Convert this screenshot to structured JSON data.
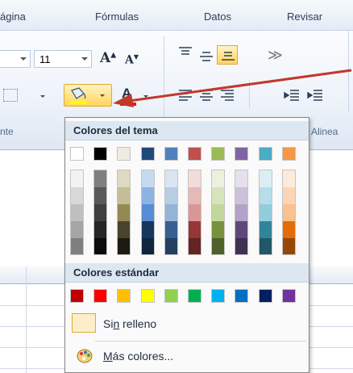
{
  "tabs": [
    "ágina",
    "Fórmulas",
    "Datos",
    "Revisar"
  ],
  "ribbon": {
    "font_size": "11",
    "group_label_font": "nte",
    "group_label_align": "Alinea"
  },
  "dropdown": {
    "theme_header": "Colores del tema",
    "standard_header": "Colores estándar",
    "no_fill_label_a": "Si",
    "no_fill_label_u": "n",
    "no_fill_label_b": " relleno",
    "more_colors_u": "M",
    "more_colors_rest": "ás colores...",
    "theme_top": [
      "#ffffff",
      "#000000",
      "#eeece1",
      "#1f497d",
      "#4f81bd",
      "#c0504d",
      "#9bbb59",
      "#8064a2",
      "#4bacc6",
      "#f79646"
    ],
    "theme_tints": [
      [
        "#f2f2f2",
        "#d8d8d8",
        "#bfbfbf",
        "#a5a5a5",
        "#7f7f7f"
      ],
      [
        "#7f7f7f",
        "#595959",
        "#3f3f3f",
        "#262626",
        "#0c0c0c"
      ],
      [
        "#ddd9c3",
        "#c4bd97",
        "#938953",
        "#494429",
        "#1d1b10"
      ],
      [
        "#c6d9f0",
        "#8db3e2",
        "#548dd4",
        "#17365d",
        "#0f243e"
      ],
      [
        "#dbe5f1",
        "#b8cce4",
        "#95b3d7",
        "#366092",
        "#244061"
      ],
      [
        "#f2dcdb",
        "#e5b9b7",
        "#d99694",
        "#953734",
        "#632423"
      ],
      [
        "#ebf1dd",
        "#d7e3bc",
        "#c3d69b",
        "#76923c",
        "#4f6128"
      ],
      [
        "#e5e0ec",
        "#ccc1d9",
        "#b2a2c7",
        "#5f497a",
        "#3f3151"
      ],
      [
        "#dbeef3",
        "#b7dde8",
        "#92cddc",
        "#31859b",
        "#205867"
      ],
      [
        "#fdeada",
        "#fbd5b5",
        "#fac08f",
        "#e36c09",
        "#974806"
      ]
    ],
    "standard": [
      "#c00000",
      "#ff0000",
      "#ffc000",
      "#ffff00",
      "#92d050",
      "#00b050",
      "#00b0f0",
      "#0070c0",
      "#002060",
      "#7030a0"
    ]
  },
  "icons": {
    "fill_bucket": "paint-bucket-icon",
    "font_color": "font-color-icon",
    "palette": "palette-icon"
  },
  "colors": {
    "accent_highlight": "#f5c242",
    "annotation_arrow": "#c0392b"
  }
}
